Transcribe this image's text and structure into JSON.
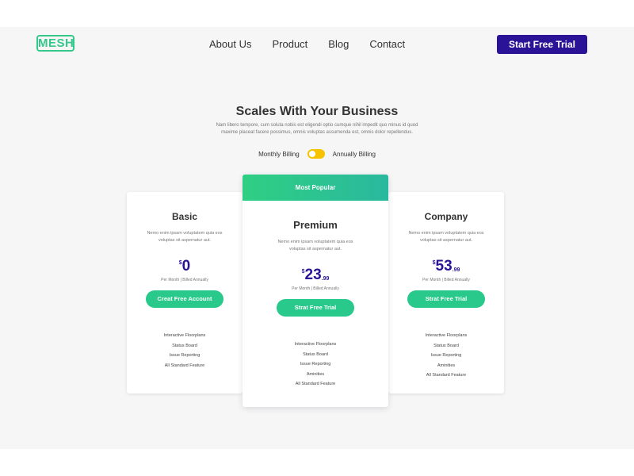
{
  "header": {
    "logo": "MESH",
    "nav": [
      "About Us",
      "Product",
      "Blog",
      "Contact"
    ],
    "cta": "Start Free Trial"
  },
  "hero": {
    "title": "Scales With Your Business",
    "description": "Nam libero tempore, cum soluta nobis est eligendi optio cumque nihil impedit quo minus id quod maxime placeat facere possimus, omnis voluptas assumenda est, omnis dolor repellendus.",
    "monthly_label": "Monthly Billing",
    "annual_label": "Annually Billing",
    "toggle_color": "#f7c300"
  },
  "plans": {
    "basic": {
      "name": "Basic",
      "description": "Nemo enim ipsam voluptatem quia eos voluptas sit aspernatur aut.",
      "currency": "$",
      "price": "0",
      "cents": "",
      "billing": "Per Month | Billed Annually",
      "button": "Creat Free Account",
      "features": [
        "Interactive Floorplans",
        "Status Board",
        "Issue Reporting",
        "All Standard Feature"
      ]
    },
    "premium": {
      "ribbon": "Most Popular",
      "name": "Premium",
      "description": "Nemo enim ipsam voluptatem quia eos voluptas sit aspernatur aut.",
      "currency": "$",
      "price": "23",
      "cents": ".99",
      "billing": "Per Month | Billed Annually",
      "button": "Strat Free Trial",
      "features": [
        "Interactive Floorplans",
        "Status Board",
        "Issue Reporting",
        "Aminities",
        "All Standard Feature"
      ]
    },
    "company": {
      "name": "Company",
      "description": "Nemo enim ipsam voluptatem quia eos voluptas sit aspernatur aut.",
      "currency": "$",
      "price": "53",
      "cents": ".99",
      "billing": "Per Month | Billed Annually",
      "button": "Strat Free Trial",
      "features": [
        "Interactive Floorplans",
        "Status Board",
        "Issue Reporting",
        "Aminities",
        "All Standard Feature"
      ]
    }
  },
  "colors": {
    "accent_green": "#28c98a",
    "brand_purple": "#2b1397"
  }
}
